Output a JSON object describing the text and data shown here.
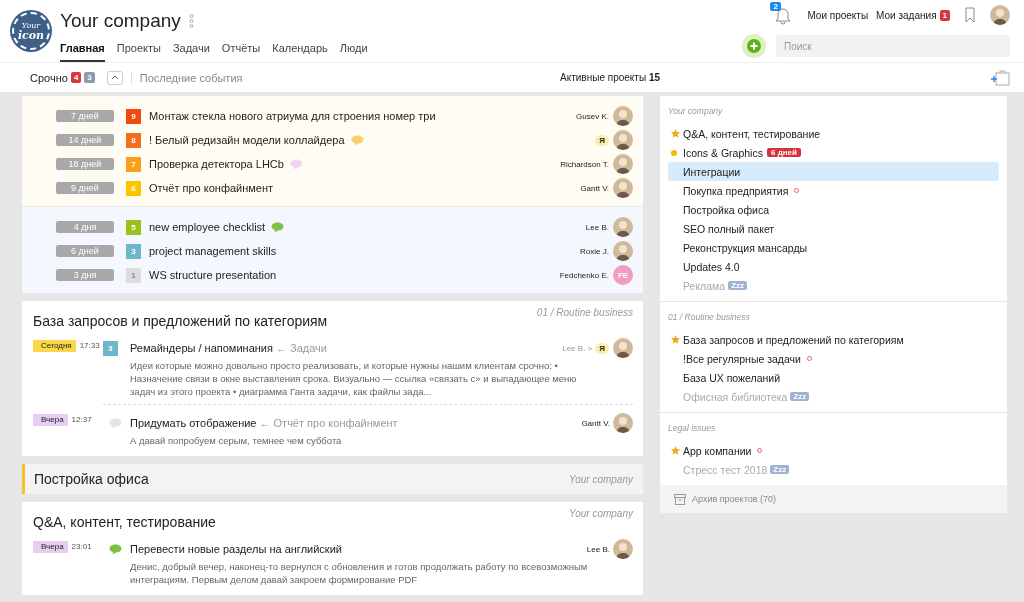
{
  "header": {
    "logo": {
      "line_1": "Your",
      "line_2": "icon"
    },
    "title": "Your company",
    "tabs": [
      {
        "label": "Главная",
        "selected": true
      },
      {
        "label": "Проекты",
        "selected": false
      },
      {
        "label": "Задачи",
        "selected": false
      },
      {
        "label": "Отчёты",
        "selected": false
      },
      {
        "label": "Календарь",
        "selected": false
      },
      {
        "label": "Люди",
        "selected": false
      }
    ],
    "notifications": "2",
    "links": [
      {
        "label": "Мои проекты"
      },
      {
        "label": "Мои задания",
        "count": "1"
      }
    ],
    "search": {
      "placeholder": "Поиск"
    }
  },
  "subbar": {
    "urgent": {
      "label": "Срочно",
      "counts": [
        {
          "value": "4",
          "color": "#d9363e"
        },
        {
          "value": "3",
          "color": "#8a9aa8"
        }
      ]
    },
    "recent": "Последние события",
    "active": {
      "label": "Активные проекты",
      "count": "15"
    }
  },
  "urgent_groups": [
    {
      "kind": "overdue",
      "rows": [
        {
          "age": "7 дней",
          "priority": "9",
          "color": "#f04a0e",
          "title": "Монтаж стекла нового атриума для строения номер три",
          "assignee": "Gusev K.",
          "me": false,
          "kind": "photo"
        },
        {
          "age": "14 дней",
          "priority": "8",
          "color": "#f36d1d",
          "title": "! Белый редизайн модели коллайдера",
          "comment": {
            "color": "#f8d06e"
          },
          "assignee": "Я",
          "me": true,
          "kind": "photo"
        },
        {
          "age": "18 дней",
          "priority": "7",
          "color": "#f7a01c",
          "title": "Проверка детектора LHCb",
          "comment": {
            "color": "#f2d5ef"
          },
          "assignee": "Richardson T.",
          "me": false,
          "kind": "photo"
        },
        {
          "age": "9 дней",
          "priority": "6",
          "color": "#fcc500",
          "title": "Отчёт про конфайнмент",
          "assignee": "Gantt V.",
          "me": false,
          "kind": "photo"
        }
      ]
    },
    {
      "kind": "upcoming",
      "rows": [
        {
          "age": "4 дня",
          "priority": "5",
          "color": "#9bc21b",
          "title": "new employee checklist",
          "comment": {
            "color": "#7dc242"
          },
          "assignee": "Lee B.",
          "me": false,
          "kind": "photo"
        },
        {
          "age": "6 дней",
          "priority": "3",
          "color": "#6cb7c9",
          "title": "project management skills",
          "assignee": "Roxie J.",
          "me": false,
          "kind": "photo"
        },
        {
          "age": "3 дня",
          "priority": "1",
          "color": "#dcdcdc",
          "title": "WS structure presentation",
          "assignee": "Fedchenko E.",
          "me": false,
          "kind": "initials",
          "initials": "FE"
        }
      ]
    }
  ],
  "feed": [
    {
      "kind": "card",
      "title": "База запросов и предложений по категориям",
      "project": "01 / Routine business",
      "entries": [
        {
          "day": {
            "label": "Сегодня",
            "color": "#fbd84a"
          },
          "time": "17:33",
          "kind": "priority",
          "priority": "3",
          "color": "#6cb7c9",
          "title": "Ремайндеры / напоминания",
          "parent": "← Задачи",
          "author": "Lee B. >",
          "me": "Я",
          "text": "Идеи которые можно довольно просто реализовать, и которые нужны нашим клиентам срочно: • Назначение связи в окне выставления срока. Визуально — ссылка «связать с» и выпадающее меню задач из этого проекта • диаграмма Ганта задачи, как файлы зада..."
        },
        {
          "day": {
            "label": "Вчера",
            "color": "#e8cdef"
          },
          "time": "12:37",
          "kind": "comment",
          "color": "#e4e4e4",
          "title": "Придумать отображение",
          "parent": "← Отчёт про конфайнмент",
          "author": "Gantt V.",
          "text": "А давай попробуем серым, темнее чем суббота"
        }
      ]
    },
    {
      "kind": "collapsed",
      "title": "Постройка офиса",
      "project": "Your company"
    },
    {
      "kind": "card",
      "title": "Q&A, контент, тестирование",
      "project": "Your company",
      "entries": [
        {
          "day": {
            "label": "Вчера",
            "color": "#e8cdef"
          },
          "time": "23:01",
          "kind": "comment",
          "color": "#7dc242",
          "title": "Перевести новые разделы на английский",
          "author": "Lee B.",
          "text": "Денис, добрый вечер, наконец-то вернулся с обновления и готов продолжать работу по всевозможным интеграциям. Первым делом давай закроем формирование PDF"
        }
      ]
    }
  ],
  "sidebar": {
    "groups": [
      {
        "label": "Your company",
        "items": [
          {
            "title": "Q&A, контент, тестирование",
            "kind": "star",
            "muted": false,
            "selected": false
          },
          {
            "title": "Icons & Graphics",
            "kind": "dot",
            "badge": "6 дней",
            "muted": false,
            "selected": false
          },
          {
            "title": "Интеграции",
            "muted": false,
            "selected": true
          },
          {
            "title": "Покупка предприятия",
            "alert": true,
            "muted": false,
            "selected": false
          },
          {
            "title": "Постройка офиса",
            "muted": false,
            "selected": false
          },
          {
            "title": "SEO полный пакет",
            "muted": false,
            "selected": false
          },
          {
            "title": "Реконструкция мансарды",
            "muted": false,
            "selected": false
          },
          {
            "title": "Updates 4.0",
            "muted": false,
            "selected": false
          },
          {
            "title": "Реклама",
            "sleep": "Zzz",
            "muted": true,
            "selected": false
          }
        ]
      },
      {
        "label": "01 / Routine business",
        "items": [
          {
            "title": "База запросов и предложений по категориям",
            "kind": "star",
            "muted": false,
            "selected": false
          },
          {
            "title": "!Все регулярные задачи",
            "alert": true,
            "muted": false,
            "selected": false
          },
          {
            "title": "База UX пожеланий",
            "muted": false,
            "selected": false
          },
          {
            "title": "Офисная библиотека",
            "sleep": "Zzz",
            "muted": true,
            "selected": false
          }
        ]
      },
      {
        "label": "Legal issues",
        "items": [
          {
            "title": "App компании",
            "kind": "star",
            "alert": true,
            "muted": false,
            "selected": false
          },
          {
            "title": "Стресс тест 2018",
            "sleep": "Zzz",
            "muted": true,
            "selected": false
          }
        ]
      }
    ],
    "archive": "Архив проектов (70)"
  }
}
